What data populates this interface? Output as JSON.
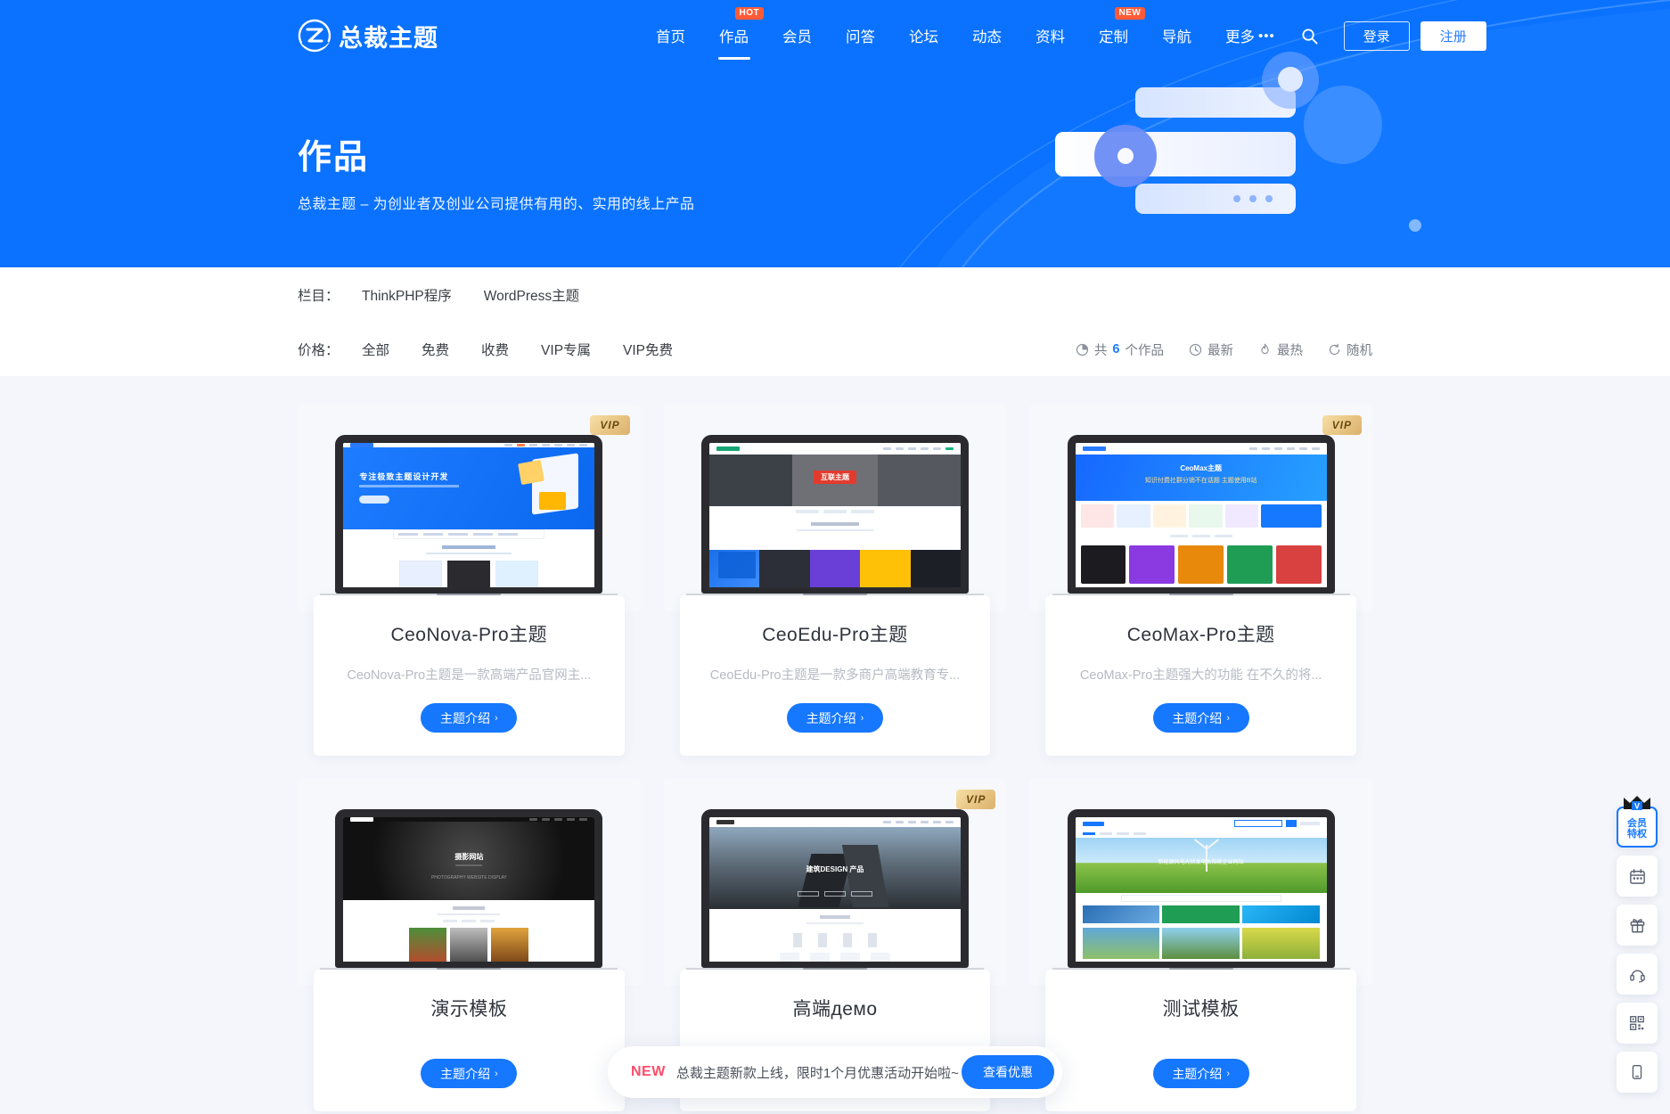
{
  "site": {
    "brand": "总裁主题",
    "logo_icon": "z-logo-icon"
  },
  "nav": {
    "items": [
      {
        "label": "首页",
        "badge": "",
        "active": false
      },
      {
        "label": "作品",
        "badge": "HOT",
        "active": true
      },
      {
        "label": "会员",
        "badge": "",
        "active": false
      },
      {
        "label": "问答",
        "badge": "",
        "active": false
      },
      {
        "label": "论坛",
        "badge": "",
        "active": false
      },
      {
        "label": "动态",
        "badge": "",
        "active": false
      },
      {
        "label": "资料",
        "badge": "",
        "active": false
      },
      {
        "label": "定制",
        "badge": "NEW",
        "active": false
      },
      {
        "label": "导航",
        "badge": "",
        "active": false
      },
      {
        "label": "更多",
        "badge": "",
        "active": false,
        "dots": "•••"
      }
    ],
    "search_icon": "search-icon",
    "login_label": "登录",
    "register_label": "注册"
  },
  "hero": {
    "title": "作品",
    "subtitle": "总裁主题 – 为创业者及创业公司提供有用的、实用的线上产品",
    "bg_color": "#0a72ff"
  },
  "filters": {
    "category_label": "栏目：",
    "categories": [
      "ThinkPHP程序",
      "WordPress主题"
    ],
    "price_label": "价格：",
    "prices": [
      "全部",
      "免费",
      "收费",
      "VIP专属",
      "VIP免费"
    ],
    "meta": [
      {
        "icon": "pie-chart-icon",
        "prefix": "共 ",
        "count": "6",
        "suffix": " 个作品"
      },
      {
        "icon": "clock-icon",
        "label": "最新"
      },
      {
        "icon": "fire-icon",
        "label": "最热"
      },
      {
        "icon": "refresh-icon",
        "label": "随机"
      }
    ]
  },
  "cards": [
    {
      "title": "CeoNova-Pro主题",
      "desc": "CeoNova-Pro主题是一款高端产品官网主...",
      "button": "主题介绍",
      "vip": "VIP",
      "thumb_style": "blue-hero",
      "thumb_headline": "专注极致主题设计开发"
    },
    {
      "title": "CeoEdu-Pro主题",
      "desc": "CeoEdu-Pro主题是一款多商户高端教育专...",
      "button": "主题介绍",
      "vip": "",
      "thumb_style": "edu-hero",
      "thumb_headline": "互联主题"
    },
    {
      "title": "CeoMax-Pro主题",
      "desc": "CeoMax-Pro主题强大的功能 在不久的将...",
      "button": "主题介绍",
      "vip": "VIP",
      "thumb_style": "max-hero",
      "thumb_headline": "CeoMax主题"
    },
    {
      "title": "演示模板",
      "desc": "",
      "button": "主题介绍",
      "vip": "",
      "thumb_style": "photo-dark",
      "thumb_headline": "摄影网站"
    },
    {
      "title": "高端демо",
      "desc": "",
      "button": "主题介绍",
      "vip": "VIP",
      "thumb_style": "arch-dark",
      "thumb_headline": "建筑DESIGN 产品"
    },
    {
      "title": "测试模板",
      "desc": "",
      "button": "主题介绍",
      "vip": "",
      "thumb_style": "green-hero",
      "thumb_headline": ""
    }
  ],
  "dock": {
    "items": [
      {
        "name": "vip-privilege",
        "label_line1": "会员",
        "label_line2": "特权",
        "icon": "crown-icon"
      },
      {
        "name": "calendar",
        "icon": "calendar-icon"
      },
      {
        "name": "gift",
        "icon": "gift-icon"
      },
      {
        "name": "support",
        "icon": "headset-icon"
      },
      {
        "name": "qrcode",
        "icon": "qrcode-icon"
      },
      {
        "name": "mobile",
        "icon": "mobile-icon"
      }
    ]
  },
  "toast": {
    "badge": "NEW",
    "text": "总裁主题新款上线，限时1个月优惠活动开始啦~",
    "button": "查看优惠"
  }
}
